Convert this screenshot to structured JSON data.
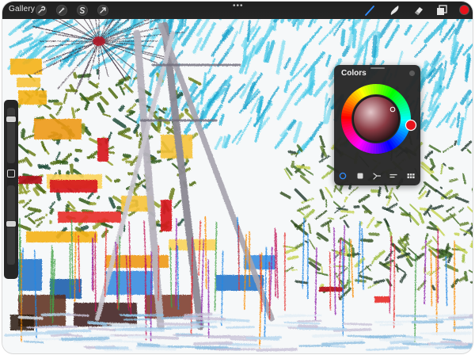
{
  "app": {
    "gallery_label": "Gallery"
  },
  "top_bar": {
    "left_tools": [
      {
        "icon": "wrench-icon",
        "name": "actions-button"
      },
      {
        "icon": "magic-wand-icon",
        "name": "adjustments-button"
      },
      {
        "icon": "selection-s-icon",
        "name": "selection-button"
      },
      {
        "icon": "transform-arrow-icon",
        "name": "transform-button"
      }
    ],
    "more_dots": "•••",
    "right_tools": [
      {
        "icon": "brush-icon",
        "name": "paint-tool-button",
        "active": true
      },
      {
        "icon": "smudge-icon",
        "name": "smudge-tool-button",
        "active": false
      },
      {
        "icon": "eraser-icon",
        "name": "eraser-tool-button",
        "active": false
      },
      {
        "icon": "layers-icon",
        "name": "layers-button",
        "active": false
      }
    ],
    "active_tool_color": "#2f8cff",
    "current_color": "#e8121b"
  },
  "sidebar": {
    "brush_size_level": 0.18,
    "opacity_level": 0.48
  },
  "colors_panel": {
    "title": "Colors",
    "selected_color": "#e8121b",
    "modes": [
      {
        "icon": "disc-icon",
        "name": "disc-mode-tab",
        "active": true
      },
      {
        "icon": "classic-square-icon",
        "name": "classic-mode-tab",
        "active": false
      },
      {
        "icon": "harmony-icon",
        "name": "harmony-mode-tab",
        "active": false
      },
      {
        "icon": "value-sliders-icon",
        "name": "value-mode-tab",
        "active": false
      },
      {
        "icon": "palettes-grid-icon",
        "name": "palettes-mode-tab",
        "active": false
      }
    ]
  }
}
